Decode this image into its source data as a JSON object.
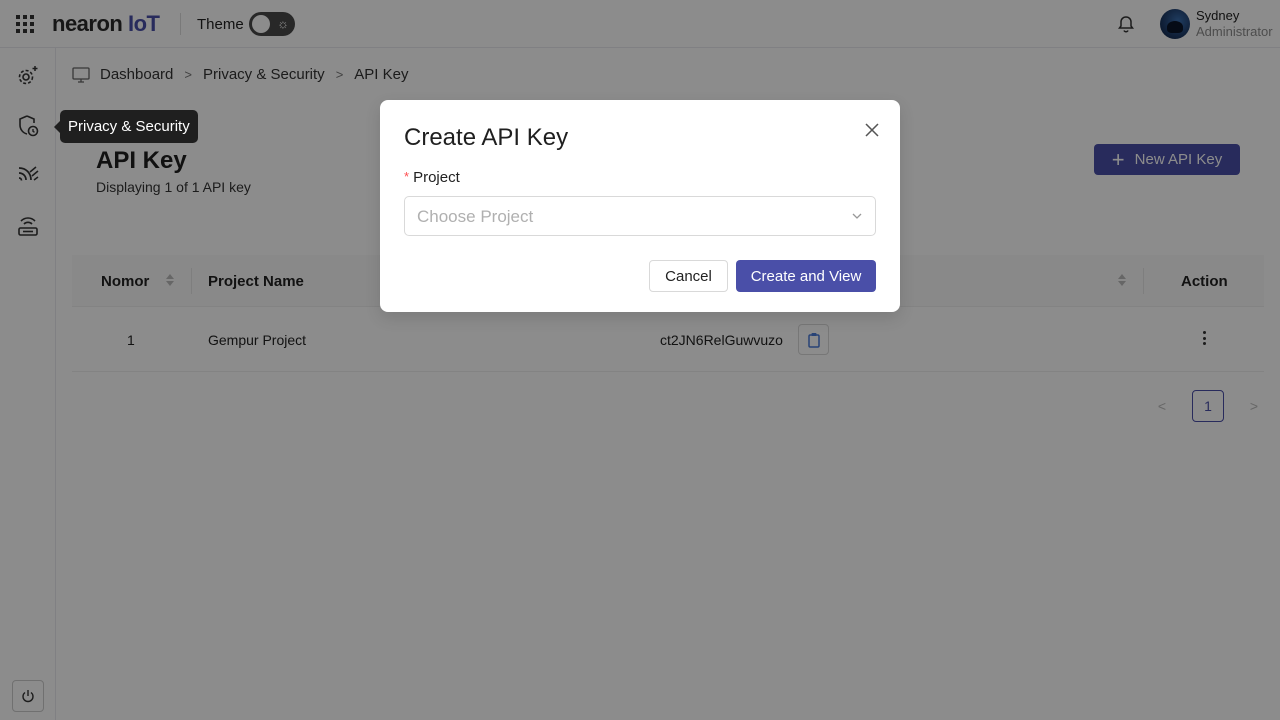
{
  "header": {
    "logo_main": "nearon",
    "logo_suffix": "IoT",
    "theme_label": "Theme",
    "user": {
      "name": "Sydney",
      "role": "Administrator"
    }
  },
  "sidebar": {
    "items": [
      {
        "icon": "settings-sparkle-icon"
      },
      {
        "icon": "shield-clock-icon",
        "tooltip": "Privacy & Security"
      },
      {
        "icon": "signal-waves-icon"
      },
      {
        "icon": "wifi-router-icon"
      }
    ],
    "footer_icon": "power-icon"
  },
  "breadcrumb": {
    "items": [
      "Dashboard",
      "Privacy & Security",
      "API Key"
    ]
  },
  "page": {
    "title": "API Key",
    "subtitle": "Displaying 1 of 1 API key",
    "new_button": "New API Key"
  },
  "table": {
    "columns": [
      "Nomor",
      "Project Name",
      "Action"
    ],
    "rows": [
      {
        "nomor": "1",
        "project": "Gempur Project",
        "api_key": "ct2JN6RelGuwvuzo"
      }
    ]
  },
  "pagination": {
    "current": "1"
  },
  "modal": {
    "title": "Create API Key",
    "field_label": "Project",
    "required_mark": "*",
    "placeholder": "Choose Project",
    "cancel": "Cancel",
    "confirm": "Create and View"
  },
  "colors": {
    "accent": "#4a4fa8",
    "required": "#ff4d4f",
    "overlay": "rgba(0,0,0,0.45)"
  }
}
